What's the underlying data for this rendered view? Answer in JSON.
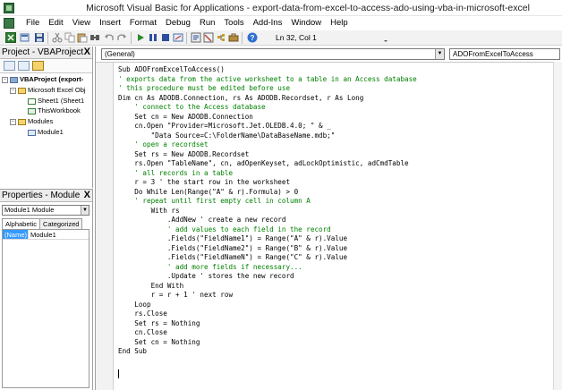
{
  "window": {
    "title": "Microsoft Visual Basic for Applications - export-data-from-excel-to-access-ado-using-vba-in-microsoft-excel"
  },
  "menu": [
    "File",
    "Edit",
    "View",
    "Insert",
    "Format",
    "Debug",
    "Run",
    "Tools",
    "Add-Ins",
    "Window",
    "Help"
  ],
  "toolbar": {
    "position_text": "Ln 32, Col 1"
  },
  "project_pane": {
    "title": "Project - VBAProject",
    "close_label": "X",
    "tree": [
      {
        "label": "VBAProject (export-",
        "expander": "-"
      },
      {
        "label": "Microsoft Excel Obj",
        "expander": "-"
      },
      {
        "label": "Sheet1 (Sheet1",
        "expander": ""
      },
      {
        "label": "ThisWorkbook",
        "expander": ""
      },
      {
        "label": "Modules",
        "expander": "-"
      },
      {
        "label": "Module1",
        "expander": ""
      }
    ]
  },
  "properties_pane": {
    "title": "Properties - Module",
    "close_label": "X",
    "object_select": "Module1 Module",
    "tabs": [
      "Alphabetic",
      "Categorized"
    ],
    "row": {
      "name": "(Name)",
      "value": "Module1"
    }
  },
  "code_window": {
    "object_combo": "(General)",
    "proc_combo": "ADOFromExcelToAccess",
    "lines": [
      "Sub ADOFromExcelToAccess()",
      "' exports data from the active worksheet to a table in an Access database",
      "' this procedure must be edited before use",
      "Dim cn As ADODB.Connection, rs As ADODB.Recordset, r As Long",
      "    ' connect to the Access database",
      "    Set cn = New ADODB.Connection",
      "    cn.Open \"Provider=Microsoft.Jet.OLEDB.4.0; \" & _",
      "        \"Data Source=C:\\FolderName\\DataBaseName.mdb;\"",
      "    ' open a recordset",
      "    Set rs = New ADODB.Recordset",
      "    rs.Open \"TableName\", cn, adOpenKeyset, adLockOptimistic, adCmdTable",
      "    ' all records in a table",
      "    r = 3 ' the start row in the worksheet",
      "    Do While Len(Range(\"A\" & r).Formula) > 0",
      "    ' repeat until first empty cell in column A",
      "        With rs",
      "            .AddNew ' create a new record",
      "            ' add values to each field in the record",
      "            .Fields(\"FieldName1\") = Range(\"A\" & r).Value",
      "            .Fields(\"FieldName2\") = Range(\"B\" & r).Value",
      "            .Fields(\"FieldNameN\") = Range(\"C\" & r).Value",
      "            ' add more fields if necessary...",
      "            .Update ' stores the new record",
      "        End With",
      "        r = r + 1 ' next row",
      "    Loop",
      "    rs.Close",
      "    Set rs = Nothing",
      "    cn.Close",
      "    Set cn = Nothing",
      "End Sub"
    ]
  }
}
